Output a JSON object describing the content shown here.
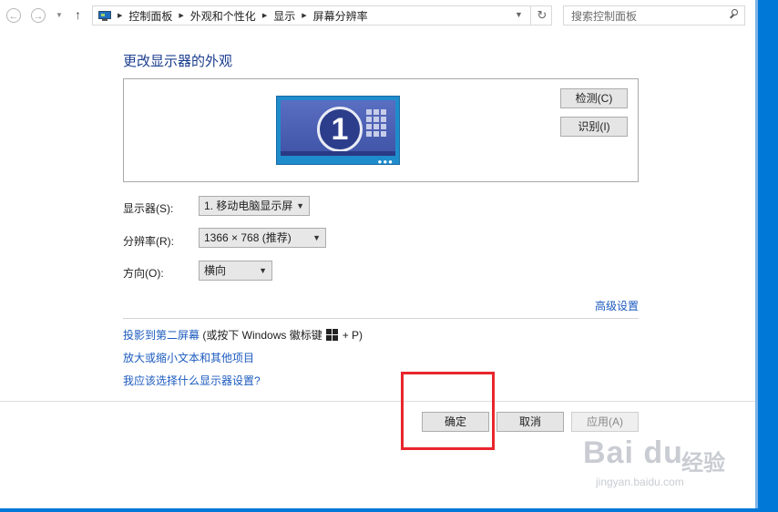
{
  "nav": {
    "breadcrumbs": [
      "控制面板",
      "外观和个性化",
      "显示",
      "屏幕分辨率"
    ],
    "search_placeholder": "搜索控制面板"
  },
  "main": {
    "title": "更改显示器的外观",
    "preview": {
      "monitor_number": "1",
      "detect_label": "检测(C)",
      "identify_label": "识别(I)"
    },
    "display_label": "显示器(S):",
    "display_value": "1. 移动电脑显示屏",
    "resolution_label": "分辨率(R):",
    "resolution_value": "1366 × 768 (推荐)",
    "orientation_label": "方向(O):",
    "orientation_value": "横向",
    "advanced_link": "高级设置",
    "project_link": "投影到第二屏幕",
    "project_hint_before": " (或按下 Windows 徽标键",
    "project_hint_after": "+ P)",
    "text_size_link": "放大或缩小文本和其他项目",
    "help_link": "我应该选择什么显示器设置?"
  },
  "footer": {
    "ok_label": "确定",
    "cancel_label": "取消",
    "apply_label": "应用(A)"
  },
  "watermark": {
    "logo": "Bai du",
    "text": "经验",
    "url": "jingyan.baidu.com"
  },
  "colors": {
    "accent": "#0078d7",
    "link": "#1c5bbf",
    "title": "#1c3e8f",
    "highlight": "#e8262d"
  }
}
